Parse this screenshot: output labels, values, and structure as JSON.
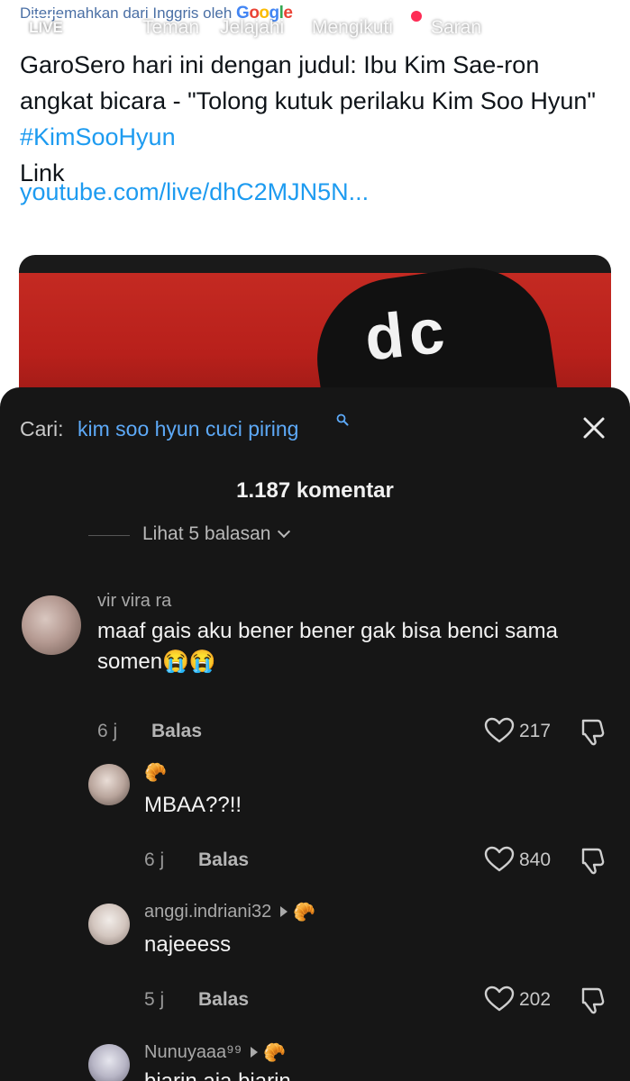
{
  "tweet": {
    "translated_prefix": "Diterjemahkan dari Inggris oleh",
    "translated_brand_letters": [
      "G",
      "o",
      "o",
      "g",
      "l",
      "e"
    ],
    "text_part1": "GaroSero hari ini dengan judul: Ibu Kim Sae-ron angkat bicara - \"Tolong kutuk perilaku Kim Soo Hyun\" ",
    "hashtag": "#KimSooHyun",
    "link_label": "Link",
    "link_url": "youtube.com/live/dhC2MJN5N..."
  },
  "nav": {
    "live": "LIVE",
    "tabs": [
      "Teman",
      "Jelajahi",
      "Mengikuti",
      "Saran"
    ],
    "icons": [
      "search-icon"
    ]
  },
  "sheet": {
    "search_label": "Cari:",
    "search_term": "kim soo hyun cuci piring",
    "comment_count": "1.187 komentar",
    "view_replies": "Lihat 5 balasan",
    "icons": [
      "close-icon",
      "search-mini-icon",
      "chevron-down-icon",
      "heart-icon",
      "dislike-icon"
    ]
  },
  "comments": [
    {
      "user": "vir vira ra",
      "text": "maaf gais aku bener bener gak bisa benci sama somen😭😭",
      "time": "6 j",
      "reply": "Balas",
      "likes": "217"
    },
    {
      "user": "",
      "badge": "🥐",
      "text": "MBAA??!!",
      "time": "6 j",
      "reply": "Balas",
      "likes": "840"
    },
    {
      "user": "anggi.indriani32",
      "badge": "🥐",
      "text": "najeeess",
      "time": "5 j",
      "reply": "Balas",
      "likes": "202"
    },
    {
      "user": "Nunuyaaa⁹⁹",
      "badge": "🥐",
      "text": "biarin aja biarin"
    }
  ],
  "colors": {
    "sheet_bg": "#161616",
    "link_blue": "#1d9bf0",
    "search_blue": "#5da9f7",
    "live_dot": "#fe2c55"
  }
}
